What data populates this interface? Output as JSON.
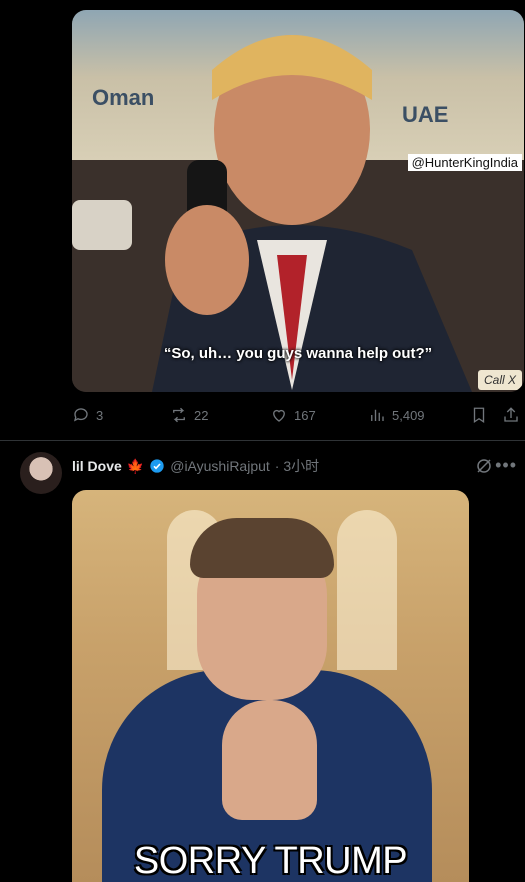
{
  "tweet1": {
    "media": {
      "map_labels": [
        "Oman",
        "UAE"
      ],
      "watermark": "@HunterKingIndia",
      "caption": "“So, uh… you guys wanna help out?”",
      "corner_text": "Call X"
    },
    "actions": {
      "replies": "3",
      "reposts": "22",
      "likes": "167",
      "views": "5,409"
    }
  },
  "tweet2": {
    "author": {
      "name": "lil Dove",
      "flag": "🍁",
      "handle": "@iAyushiRajput",
      "time": "· 3小时"
    },
    "media": {
      "caption": "SORRY TRUMP"
    }
  },
  "colors": {
    "background": "#000000",
    "text": "#e7e9ea",
    "muted": "#71767b",
    "verified": "#1d9bf0",
    "divider": "#2f3336"
  },
  "icons": [
    "reply-icon",
    "repost-icon",
    "like-icon",
    "views-icon",
    "bookmark-icon",
    "share-icon",
    "verified-icon",
    "grok-icon",
    "more-icon"
  ]
}
